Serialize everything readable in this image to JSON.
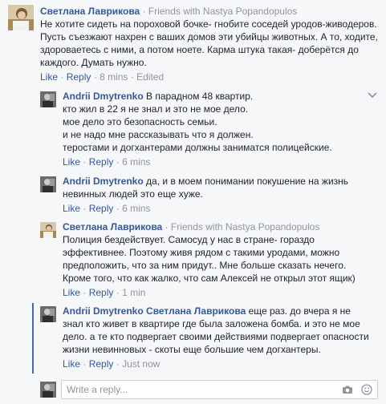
{
  "comments": [
    {
      "author": "Светлана Лаврикова",
      "context_sep": " · Friends with ",
      "context_friend": "Nastya Popandopulos",
      "text": "Не хотите сидеть на пороховой бочке- гнобите соседей уродов-живодеров. Пусть съезжают нахрен с ваших домов эти убийцы животных. А то, ходите, здороваетесь с ними, а потом ноете. Карма штука такая- доберётся до каждого. Думать нужно.",
      "like": "Like",
      "reply": "Reply",
      "time": "8 mins",
      "edited": "Edited"
    },
    {
      "author": "Andrii Dmytrenko",
      "text_lines": [
        "В парадном 48 квартир.",
        "кто жил в 22 я не знал и это не мое дело.",
        "мое дело это безопасность семьи.",
        "и не надо мне рассказывать что я должен.",
        "теростами и догхантерами должны заниматся полицейские."
      ],
      "like": "Like",
      "reply": "Reply",
      "time": "6 mins"
    },
    {
      "author": "Andrii Dmytrenko",
      "text": "да, и в моем понимании покушение на жизнь невинных людей это еще хуже.",
      "like": "Like",
      "reply": "Reply",
      "time": "6 mins"
    },
    {
      "author": "Светлана Лаврикова",
      "context_sep": " · Friends with ",
      "context_friend": "Nastya Popandopulos",
      "text": "Полиция бездействует. Самосуд у нас в стране- гораздо эффективнее. Поэтому живя рядом с такими уродами, можно предположить, что за ним придут.. Мне больше сказать нечего. Кроме того, что как жалко, что сам Алексей не открыл этот ящик)",
      "like": "Like",
      "reply": "Reply",
      "time": "1 min"
    },
    {
      "author": "Andrii Dmytrenko",
      "mention": "Светлана Лаврикова",
      "text": " еще раз. до вчера я не знал кто живет в квартире где была заложена бомба. и это не мое дело. а те кто подвергает своими действиями подвергает опасности жизни невинновых - скоты еще большие чем догхантеры.",
      "like": "Like",
      "reply": "Reply",
      "time": "Just now"
    }
  ],
  "dot": "·",
  "reply_box": {
    "placeholder": "Write a reply..."
  },
  "icons": [
    "chevron-down-icon",
    "camera-icon",
    "emoji-icon"
  ],
  "colors": {
    "link": "#365899",
    "meta": "#90949c",
    "background": "#f6f7f9",
    "thread": "#4267b2"
  }
}
